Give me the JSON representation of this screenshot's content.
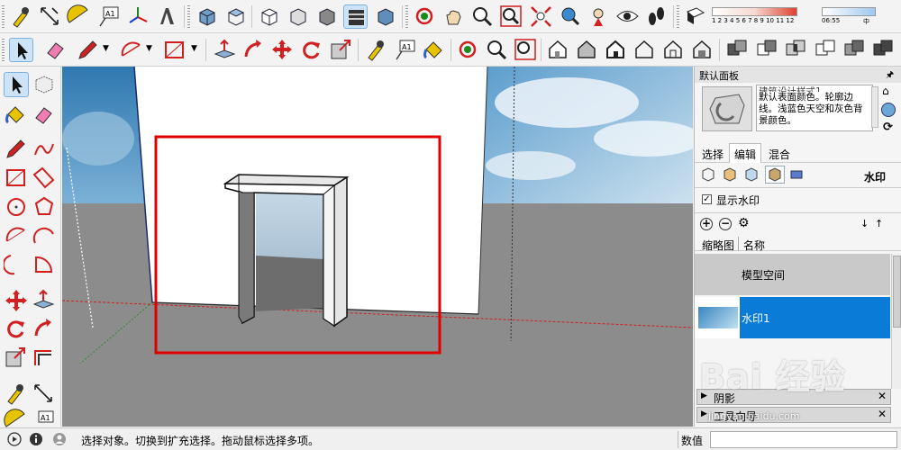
{
  "toolbar": {
    "row1_tools": [
      "tape-measure",
      "dimension",
      "protractor",
      "text",
      "axes",
      "3d-text",
      "iso-view",
      "top-view",
      "front-view",
      "right-view",
      "back-view",
      "left-view",
      "orbit",
      "pan",
      "zoom",
      "zoom-window",
      "zoom-extents",
      "previous-view",
      "position-camera",
      "look-around",
      "walk",
      "section-plane"
    ],
    "row2_tools": [
      "select",
      "eraser",
      "pencil",
      "arc",
      "rectangle",
      "push-pull",
      "follow-me",
      "move",
      "rotate",
      "scale",
      "tape-measure",
      "text",
      "paint-bucket",
      "orbit",
      "zoom",
      "house-view",
      "house-top",
      "house-front",
      "house-outline",
      "house-back",
      "solid-union",
      "solid-subtract",
      "solid-intersect",
      "solid-trim",
      "solid-split",
      "solid-outer-shell"
    ],
    "shadow": {
      "month_scale": "1 2 3 4 5 6 7 8 9 10 11 12",
      "time_label": "06:55",
      "noon_label": "中"
    }
  },
  "panel": {
    "title": "默认面板",
    "style_description": "默认表面颜色。轮廓边线。浅蓝色天空和灰色背景颜色。",
    "style_name": "建筑设计样式1",
    "tabs": [
      "选择",
      "编辑",
      "混合"
    ],
    "active_tab": "编辑",
    "section_label": "水印",
    "show_watermark": {
      "label": "显示水印",
      "checked": true
    },
    "list_header": {
      "col1": "缩略图",
      "col2": "名称"
    },
    "rows": [
      {
        "name": "模型空间",
        "selected": false
      },
      {
        "name": "水印1",
        "selected": true
      }
    ],
    "collapsed_sections": [
      "阴影",
      "工具向导"
    ]
  },
  "status": {
    "message": "选择对象。切换到扩充选择。拖动鼠标选择多项。",
    "measurement_label": "数值",
    "measurement_value": ""
  },
  "watermark": {
    "logo_text": "Bai 经验",
    "url": "jingyan.baidu.com"
  },
  "colors": {
    "selection_blue": "#0a7cd8",
    "highlight_red": "#e00000",
    "ground_gray": "#8c8c8c",
    "sky_blue": "#3f86b8"
  }
}
